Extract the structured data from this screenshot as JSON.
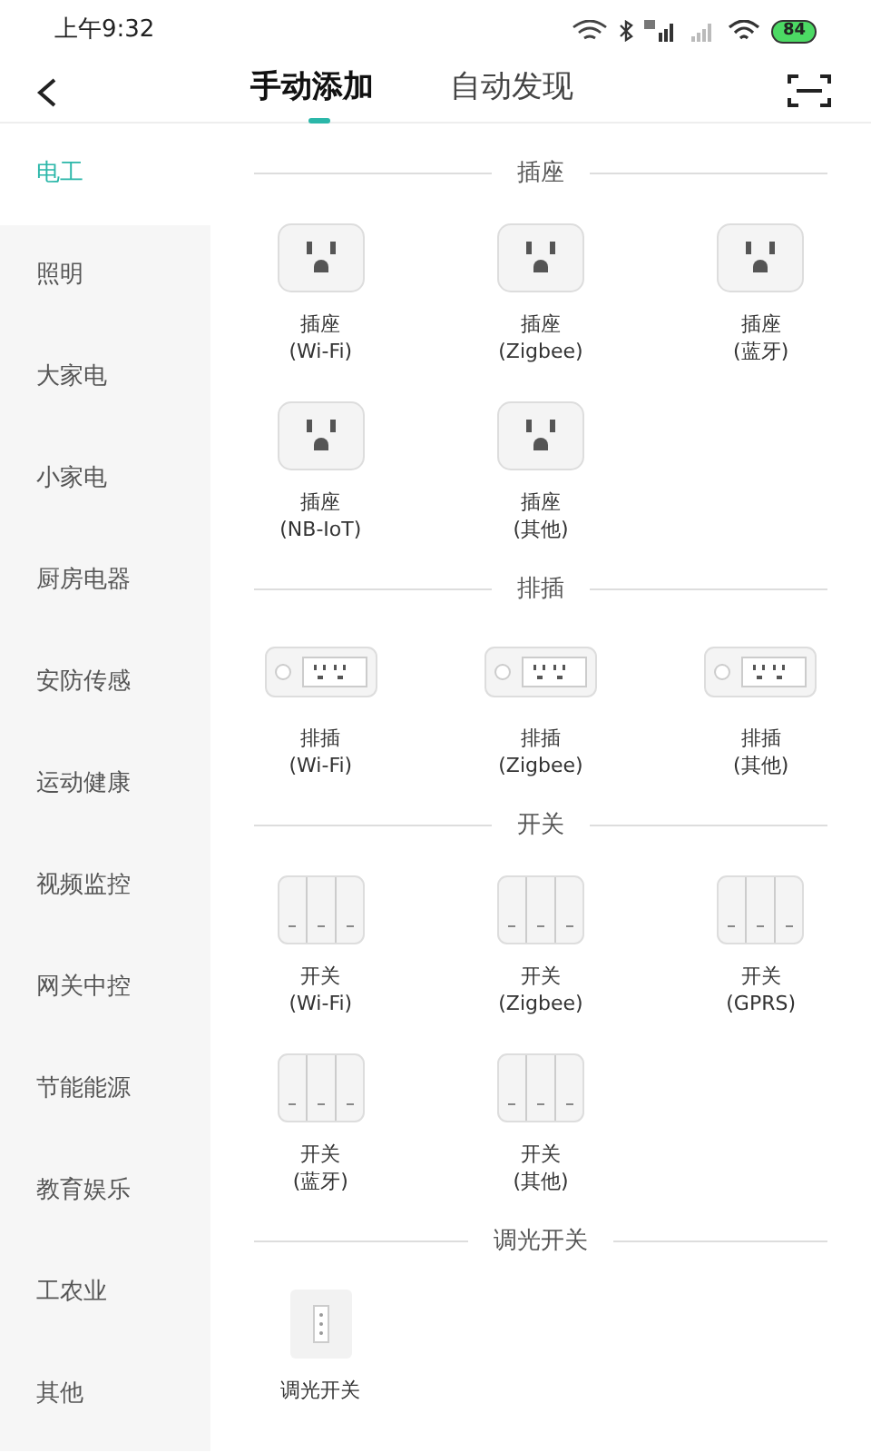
{
  "status_bar": {
    "time": "上午9:32",
    "battery": "84"
  },
  "header": {
    "tabs": [
      {
        "label": "手动添加",
        "selected": true
      },
      {
        "label": "自动发现",
        "selected": false
      }
    ]
  },
  "sidebar": {
    "items": [
      {
        "label": "电工",
        "selected": true
      },
      {
        "label": "照明",
        "selected": false
      },
      {
        "label": "大家电",
        "selected": false
      },
      {
        "label": "小家电",
        "selected": false
      },
      {
        "label": "厨房电器",
        "selected": false
      },
      {
        "label": "安防传感",
        "selected": false
      },
      {
        "label": "运动健康",
        "selected": false
      },
      {
        "label": "视频监控",
        "selected": false
      },
      {
        "label": "网关中控",
        "selected": false
      },
      {
        "label": "节能能源",
        "selected": false
      },
      {
        "label": "教育娱乐",
        "selected": false
      },
      {
        "label": "工农业",
        "selected": false
      },
      {
        "label": "其他",
        "selected": false
      }
    ]
  },
  "sections": [
    {
      "title": "插座",
      "items": [
        {
          "kind": "socket",
          "name": "插座",
          "protocol": "(Wi-Fi)"
        },
        {
          "kind": "socket",
          "name": "插座",
          "protocol": "(Zigbee)"
        },
        {
          "kind": "socket",
          "name": "插座",
          "protocol": "(蓝牙)"
        },
        {
          "kind": "socket",
          "name": "插座",
          "protocol": "(NB-IoT)"
        },
        {
          "kind": "socket",
          "name": "插座",
          "protocol": "(其他)"
        }
      ]
    },
    {
      "title": "排插",
      "items": [
        {
          "kind": "strip",
          "name": "排插",
          "protocol": "(Wi-Fi)"
        },
        {
          "kind": "strip",
          "name": "排插",
          "protocol": "(Zigbee)"
        },
        {
          "kind": "strip",
          "name": "排插",
          "protocol": "(其他)"
        }
      ]
    },
    {
      "title": "开关",
      "items": [
        {
          "kind": "switch",
          "name": "开关",
          "protocol": "(Wi-Fi)"
        },
        {
          "kind": "switch",
          "name": "开关",
          "protocol": "(Zigbee)"
        },
        {
          "kind": "switch",
          "name": "开关",
          "protocol": "(GPRS)"
        },
        {
          "kind": "switch",
          "name": "开关",
          "protocol": "(蓝牙)"
        },
        {
          "kind": "switch",
          "name": "开关",
          "protocol": "(其他)"
        }
      ]
    },
    {
      "title": "调光开关",
      "items": [
        {
          "kind": "dimmer",
          "name": "调光开关"
        }
      ]
    }
  ]
}
